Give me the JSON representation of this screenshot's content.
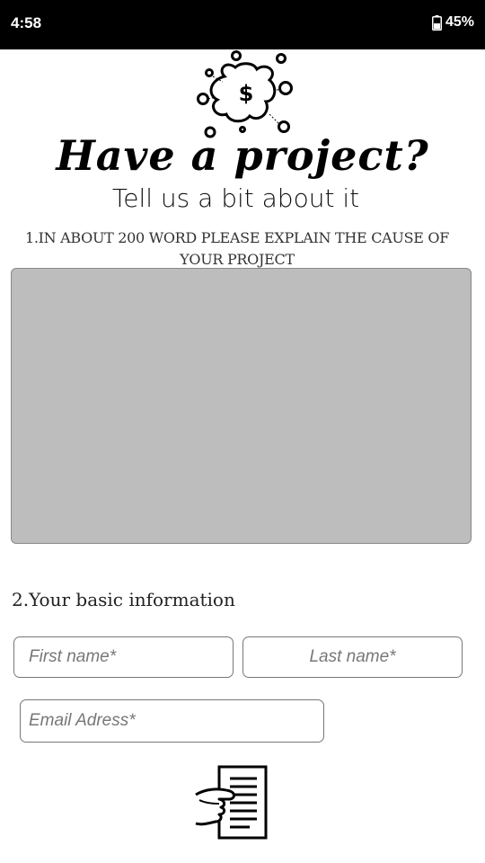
{
  "status_bar": {
    "time": "4:58",
    "battery": "45%"
  },
  "hero": {
    "icon": "money-bubbles-icon"
  },
  "title": "Have a project?",
  "subtitle": "Tell us a bit about it",
  "question_1": "1.IN ABOUT 200 WORD PLEASE EXPLAIN THE CAUSE OF YOUR PROJECT",
  "cause_field": {
    "value": ""
  },
  "question_2": "2.Your basic information",
  "form": {
    "first_name_placeholder": "First name*",
    "last_name_placeholder": "Last name*",
    "email_placeholder": "Email Adress*"
  },
  "footer": {
    "icon": "document-in-hand-icon"
  }
}
